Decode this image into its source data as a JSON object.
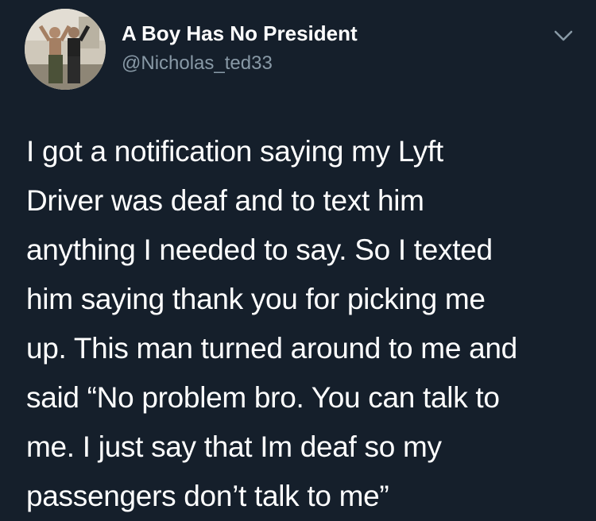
{
  "tweet": {
    "display_name": "A Boy Has No President",
    "handle": "@Nicholas_ted33",
    "lines": [
      "I got a notification saying my Lyft",
      "Driver was deaf and to text him",
      "anything I needed to say. So I texted",
      "him saying thank you for picking me",
      "up. This man turned around to me and",
      "said “No problem bro. You can talk to",
      "me. I just say that Im deaf so my",
      "passengers don’t talk to me”"
    ],
    "menu_icon": "chevron-down-icon",
    "avatar_icon": "profile-photo"
  },
  "colors": {
    "background": "#151f2b",
    "text": "#ffffff",
    "secondary_text": "#8899a6"
  }
}
